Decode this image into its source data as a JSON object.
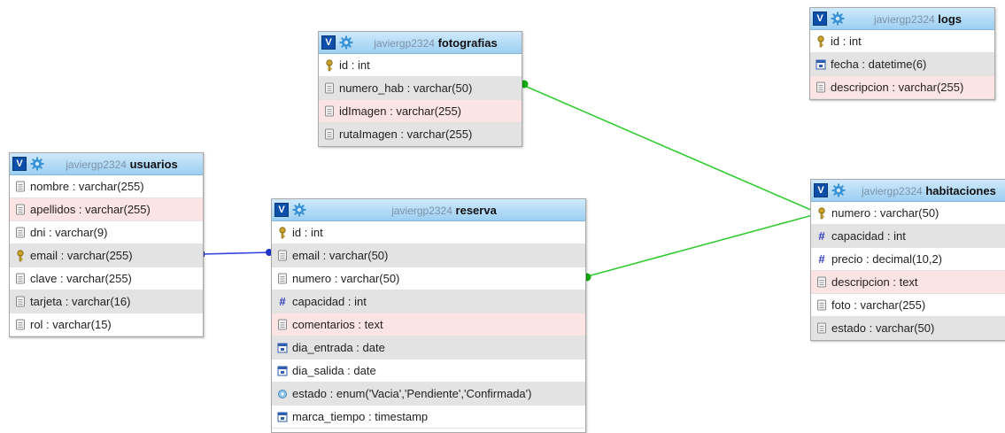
{
  "tables": [
    {
      "db": "javiergp2324",
      "name": "fotografias",
      "columns": [
        {
          "label": "id : int",
          "icon": "key-icon"
        },
        {
          "label": "numero_hab : varchar(50)",
          "icon": "column-icon"
        },
        {
          "label": "idImagen : varchar(255)",
          "icon": "column-icon"
        },
        {
          "label": "rutaImagen : varchar(255)",
          "icon": "column-icon"
        }
      ]
    },
    {
      "db": "javiergp2324",
      "name": "logs",
      "columns": [
        {
          "label": "id : int",
          "icon": "key-icon"
        },
        {
          "label": "fecha : datetime(6)",
          "icon": "date-icon"
        },
        {
          "label": "descripcion : varchar(255)",
          "icon": "column-icon"
        }
      ]
    },
    {
      "db": "javiergp2324",
      "name": "usuarios",
      "columns": [
        {
          "label": "nombre : varchar(255)",
          "icon": "column-icon"
        },
        {
          "label": "apellidos : varchar(255)",
          "icon": "column-icon"
        },
        {
          "label": "dni : varchar(9)",
          "icon": "column-icon"
        },
        {
          "label": "email : varchar(255)",
          "icon": "key-icon"
        },
        {
          "label": "clave : varchar(255)",
          "icon": "column-icon"
        },
        {
          "label": "tarjeta : varchar(16)",
          "icon": "column-icon"
        },
        {
          "label": "rol : varchar(15)",
          "icon": "column-icon"
        }
      ]
    },
    {
      "db": "javiergp2324",
      "name": "reserva",
      "columns": [
        {
          "label": "id : int",
          "icon": "key-icon"
        },
        {
          "label": "email : varchar(50)",
          "icon": "column-icon"
        },
        {
          "label": "numero : varchar(50)",
          "icon": "column-icon"
        },
        {
          "label": "capacidad : int",
          "icon": "numeric-icon"
        },
        {
          "label": "comentarios : text",
          "icon": "column-icon"
        },
        {
          "label": "dia_entrada : date",
          "icon": "date-icon"
        },
        {
          "label": "dia_salida : date",
          "icon": "date-icon"
        },
        {
          "label": "estado : enum('Vacia','Pendiente','Confirmada')",
          "icon": "enum-icon"
        },
        {
          "label": "marca_tiempo : timestamp",
          "icon": "date-icon"
        }
      ]
    },
    {
      "db": "javiergp2324",
      "name": "habitaciones",
      "columns": [
        {
          "label": "numero : varchar(50)",
          "icon": "key-icon"
        },
        {
          "label": "capacidad : int",
          "icon": "numeric-icon"
        },
        {
          "label": "precio : decimal(10,2)",
          "icon": "numeric-icon"
        },
        {
          "label": "descripcion : text",
          "icon": "column-icon"
        },
        {
          "label": "foto : varchar(255)",
          "icon": "column-icon"
        },
        {
          "label": "estado : varchar(50)",
          "icon": "column-icon"
        }
      ]
    }
  ],
  "ui": {
    "toggle_label": "V",
    "icons": {
      "settings": "gear-icon"
    }
  },
  "relations": [
    {
      "from": "fotografias.numero_hab",
      "to": "habitaciones.numero",
      "color": "#22cc22"
    },
    {
      "from": "reserva.numero",
      "to": "habitaciones.numero",
      "color": "#22cc22"
    },
    {
      "from": "usuarios.email",
      "to": "reserva.email",
      "color": "#2233cc"
    }
  ],
  "colors": {
    "header": "#9ccff2",
    "toggle": "#0d4fa8",
    "row_alt": "#e3e3e3",
    "row_highlight": "#fce3e4",
    "fk_green": "#22cc22",
    "fk_blue": "#2233cc"
  }
}
